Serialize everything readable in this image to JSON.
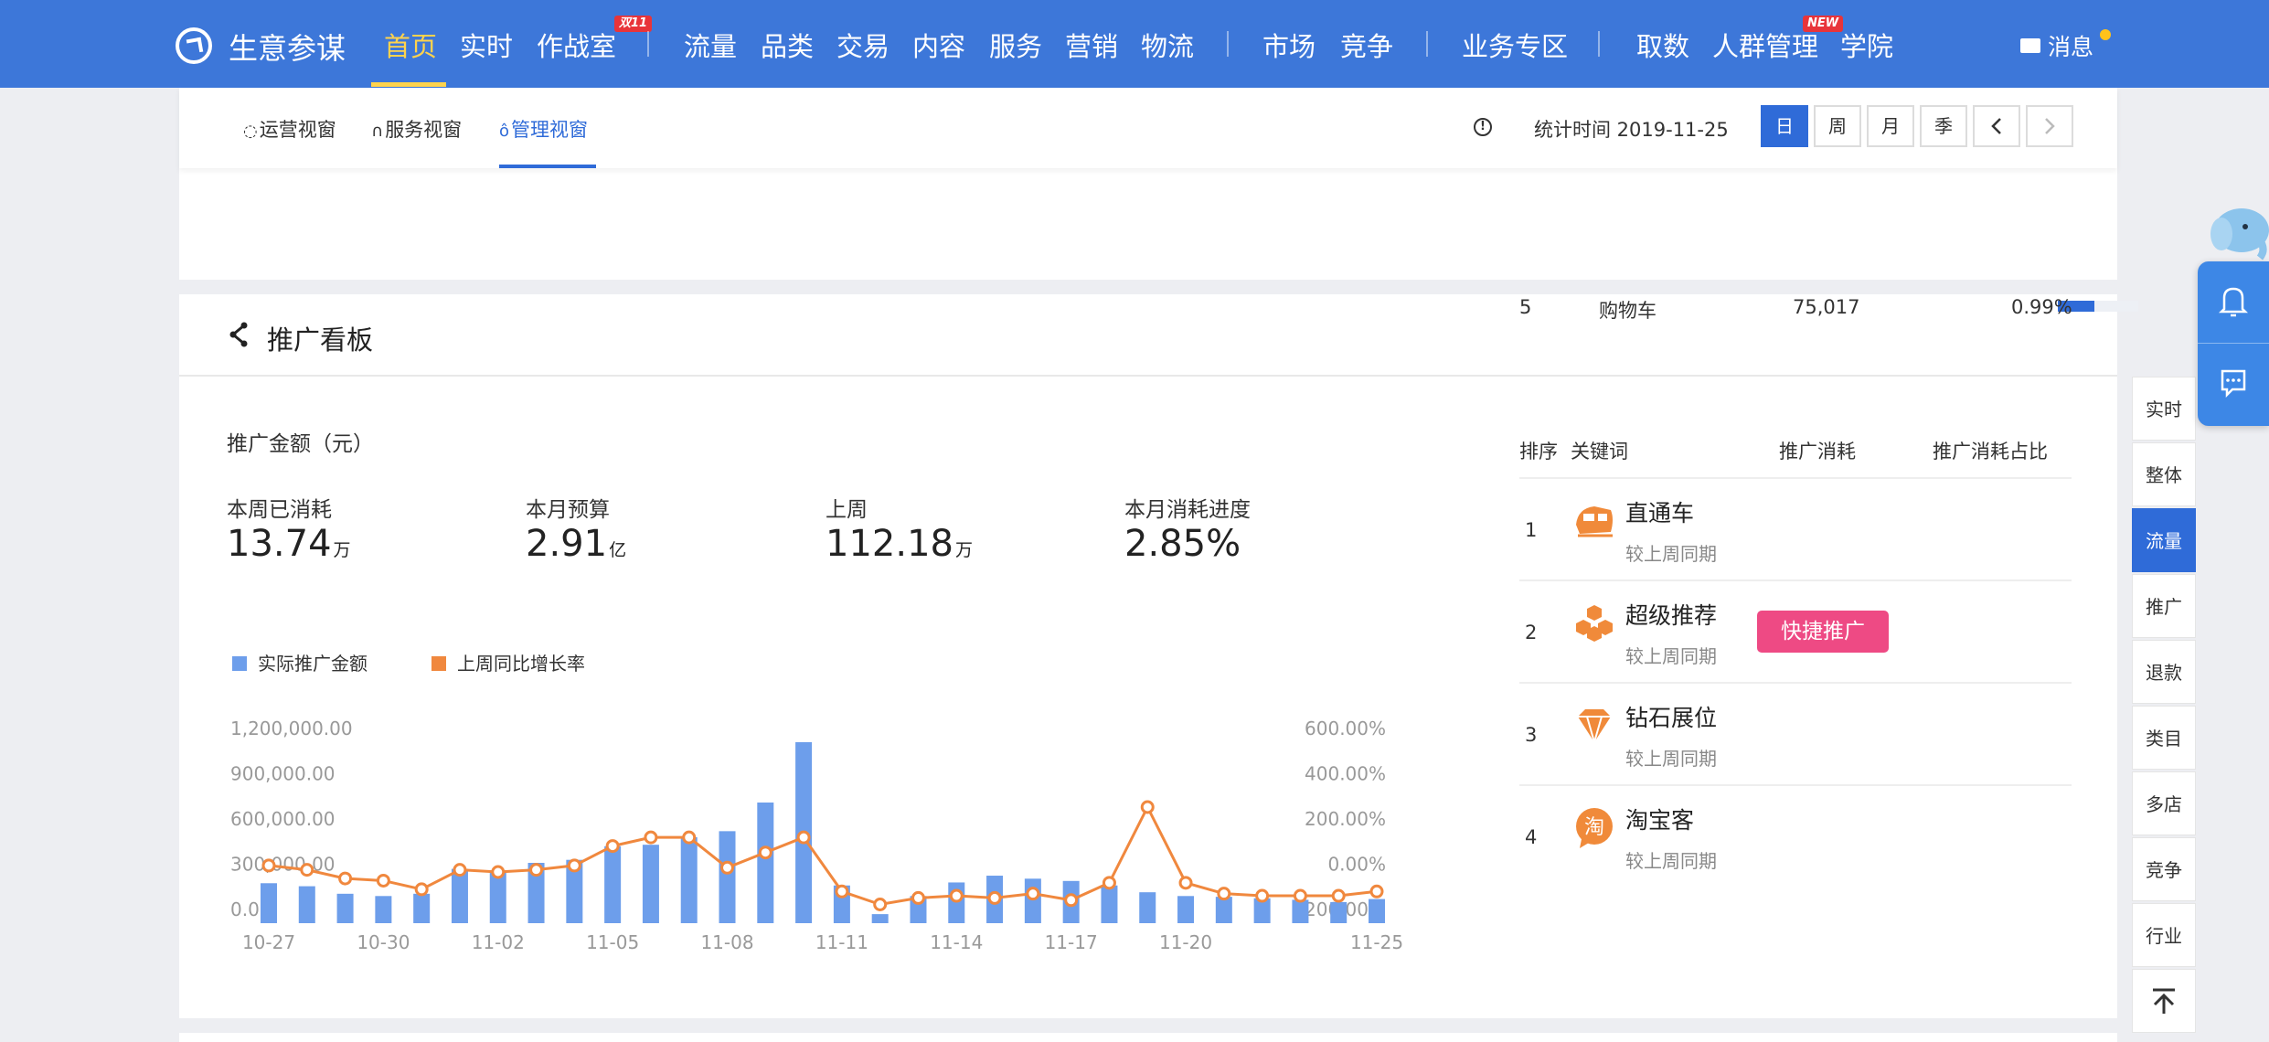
{
  "nav": {
    "brand": "生意参谋",
    "items": [
      "首页",
      "实时",
      "作战室",
      "流量",
      "品类",
      "交易",
      "内容",
      "服务",
      "营销",
      "物流",
      "市场",
      "竞争",
      "业务专区",
      "取数",
      "人群管理",
      "学院"
    ],
    "badge_double11": "双11",
    "badge_new": "NEW",
    "message": "消息"
  },
  "subbar": {
    "tabs": [
      "运营视窗",
      "服务视窗",
      "管理视窗"
    ],
    "stat_time": "统计时间 2019-11-25",
    "periods": [
      "日",
      "周",
      "月",
      "季"
    ]
  },
  "upper_row": {
    "rank": "5",
    "name": "购物车",
    "value": "75,017",
    "share": "0.99%",
    "bar_fraction": 0.45
  },
  "board": {
    "title": "推广看板",
    "amount_title": "推广金额（元）",
    "metrics": [
      {
        "label": "本周已消耗",
        "value": "13.74",
        "unit": "万"
      },
      {
        "label": "本月预算",
        "value": "2.91",
        "unit": "亿"
      },
      {
        "label": "上周",
        "value": "112.18",
        "unit": "万"
      },
      {
        "label": "本月消耗进度",
        "value": "2.85%",
        "unit": ""
      }
    ],
    "legend": [
      "实际推广金额",
      "上周同比增长率"
    ],
    "table": {
      "headers": [
        "排序",
        "关键词",
        "推广消耗",
        "推广消耗占比"
      ],
      "rows": [
        {
          "rank": "1",
          "name": "直通车",
          "sub": "较上周同期"
        },
        {
          "rank": "2",
          "name": "超级推荐",
          "sub": "较上周同期"
        },
        {
          "rank": "3",
          "name": "钻石展位",
          "sub": "较上周同期"
        },
        {
          "rank": "4",
          "name": "淘宝客",
          "sub": "较上周同期"
        }
      ],
      "quick_button": "快捷推广"
    }
  },
  "side_nav": [
    "实时",
    "整体",
    "流量",
    "推广",
    "退款",
    "类目",
    "多店",
    "竞争",
    "行业"
  ],
  "colors": {
    "nav_bg": "#3d77d9",
    "accent": "#2f6bd8",
    "bar": "#6d9eeb",
    "line": "#f0883e",
    "quick": "#ee4a84"
  },
  "chart_data": {
    "type": "bar",
    "x": [
      "10-27",
      "10-28",
      "10-29",
      "10-30",
      "10-31",
      "11-01",
      "11-02",
      "11-03",
      "11-04",
      "11-05",
      "11-06",
      "11-07",
      "11-08",
      "11-09",
      "11-10",
      "11-11",
      "11-12",
      "11-13",
      "11-14",
      "11-15",
      "11-16",
      "11-17",
      "11-18",
      "11-19",
      "11-20",
      "11-21",
      "11-22",
      "11-23",
      "11-24",
      "11-25"
    ],
    "x_ticks": [
      "10-27",
      "10-30",
      "11-02",
      "11-05",
      "11-08",
      "11-11",
      "11-14",
      "11-17",
      "11-20",
      "11-25"
    ],
    "series": [
      {
        "name": "实际推广金额",
        "type": "bar",
        "axis": "left",
        "values": [
          265000,
          245000,
          195000,
          180000,
          195000,
          360000,
          350000,
          400000,
          420000,
          510000,
          520000,
          570000,
          610000,
          800000,
          1200000,
          250000,
          60000,
          180000,
          270000,
          315000,
          295000,
          280000,
          250000,
          205000,
          180000,
          175000,
          165000,
          155000,
          140000,
          160000
        ]
      },
      {
        "name": "上周同比增长率",
        "type": "line",
        "axis": "right",
        "values": [
          30,
          10,
          -30,
          -40,
          -80,
          10,
          0,
          10,
          30,
          120,
          160,
          160,
          20,
          90,
          160,
          -90,
          -150,
          -120,
          -110,
          -120,
          -100,
          -130,
          -50,
          300,
          -50,
          -100,
          -110,
          -110,
          -110,
          -90
        ]
      }
    ],
    "left_axis": {
      "ticks": [
        "1,200,000.00",
        "900,000.00",
        "600,000.00",
        "300,000.00",
        "0.00"
      ],
      "ylim": [
        0,
        1200000
      ]
    },
    "right_axis": {
      "ticks": [
        "600.00%",
        "400.00%",
        "200.00%",
        "0.00%",
        "-200.00%"
      ],
      "ylim": [
        -200,
        600
      ]
    }
  }
}
